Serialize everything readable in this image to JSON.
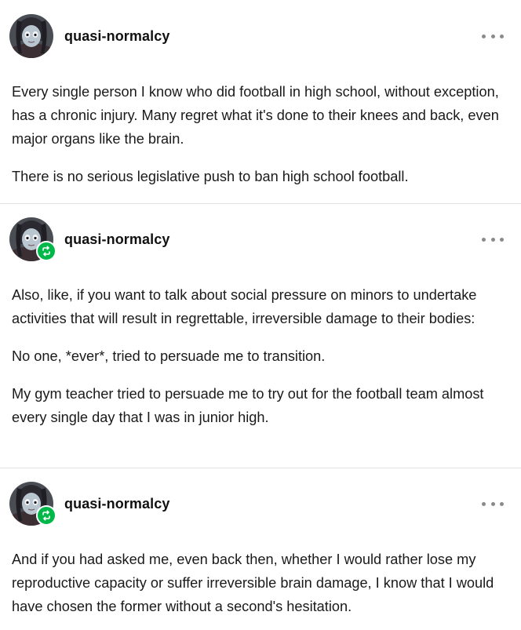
{
  "posts": [
    {
      "username": "quasi-normalcy",
      "reblogged": false,
      "paragraphs": [
        "Every single person I know who did football in high school, without exception, has a chronic injury. Many regret what it's done to their knees and back, even major organs like the brain.",
        "There is no serious legislative push to ban high school football."
      ]
    },
    {
      "username": "quasi-normalcy",
      "reblogged": true,
      "paragraphs": [
        "Also, like, if you want to talk about social pressure on minors to undertake activities that will result in regrettable, irreversible damage to their bodies:",
        "No one, *ever*, tried to persuade me to transition.",
        "My gym teacher tried to persuade me to try out for the football team almost every single day that I was in junior high."
      ]
    },
    {
      "username": "quasi-normalcy",
      "reblogged": true,
      "paragraphs": [
        "And if you had asked me, even back then, whether I would rather lose my reproductive capacity or suffer irreversible brain damage, I know that I would have chosen the former without a second's hesitation."
      ]
    }
  ],
  "icons": {
    "avatar": "avatar-icon",
    "reblog": "reblog-icon",
    "more": "more-options-icon"
  },
  "colors": {
    "reblog_badge": "#00b84a",
    "divider": "#e3e3e3",
    "text": "#1a1a1a"
  }
}
